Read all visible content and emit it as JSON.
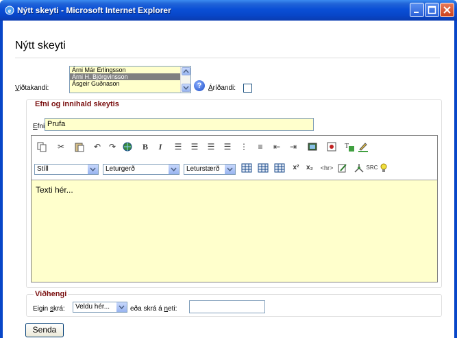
{
  "window": {
    "title": "Nýtt skeyti - Microsoft Internet Explorer"
  },
  "page": {
    "heading": "Nýtt skeyti"
  },
  "recipients": {
    "label": "Viðtakandi:",
    "options": [
      "Árni Már Erlingsson",
      "Árni H. Björgvinsson",
      "Ásgeir Guðnason"
    ],
    "selected_index": 1,
    "cc_label": "Áríðandi:",
    "urgent_checked": false
  },
  "content_section": {
    "legend": "Efni og innihald skeytis",
    "subject_label": "Efni:",
    "subject_value": "Prufa"
  },
  "toolbar": {
    "style_select": "Stíll",
    "font_select": "Leturgerð",
    "size_select": "Leturstærð",
    "hr_label": "<hr>",
    "src_label": "SRC"
  },
  "editor": {
    "body_text": "Texti hér..."
  },
  "attachments": {
    "legend": "Viðhengi",
    "own_file_label": "Eigin skrá:",
    "own_file_select": "Veldu hér...",
    "or_label": "eða skrá á neti:",
    "web_file_value": ""
  },
  "actions": {
    "send_label": "Senda"
  },
  "colors": {
    "titlebar": "#0a4fd6",
    "legend": "#7a1010",
    "input_bg": "#ffffcc"
  }
}
